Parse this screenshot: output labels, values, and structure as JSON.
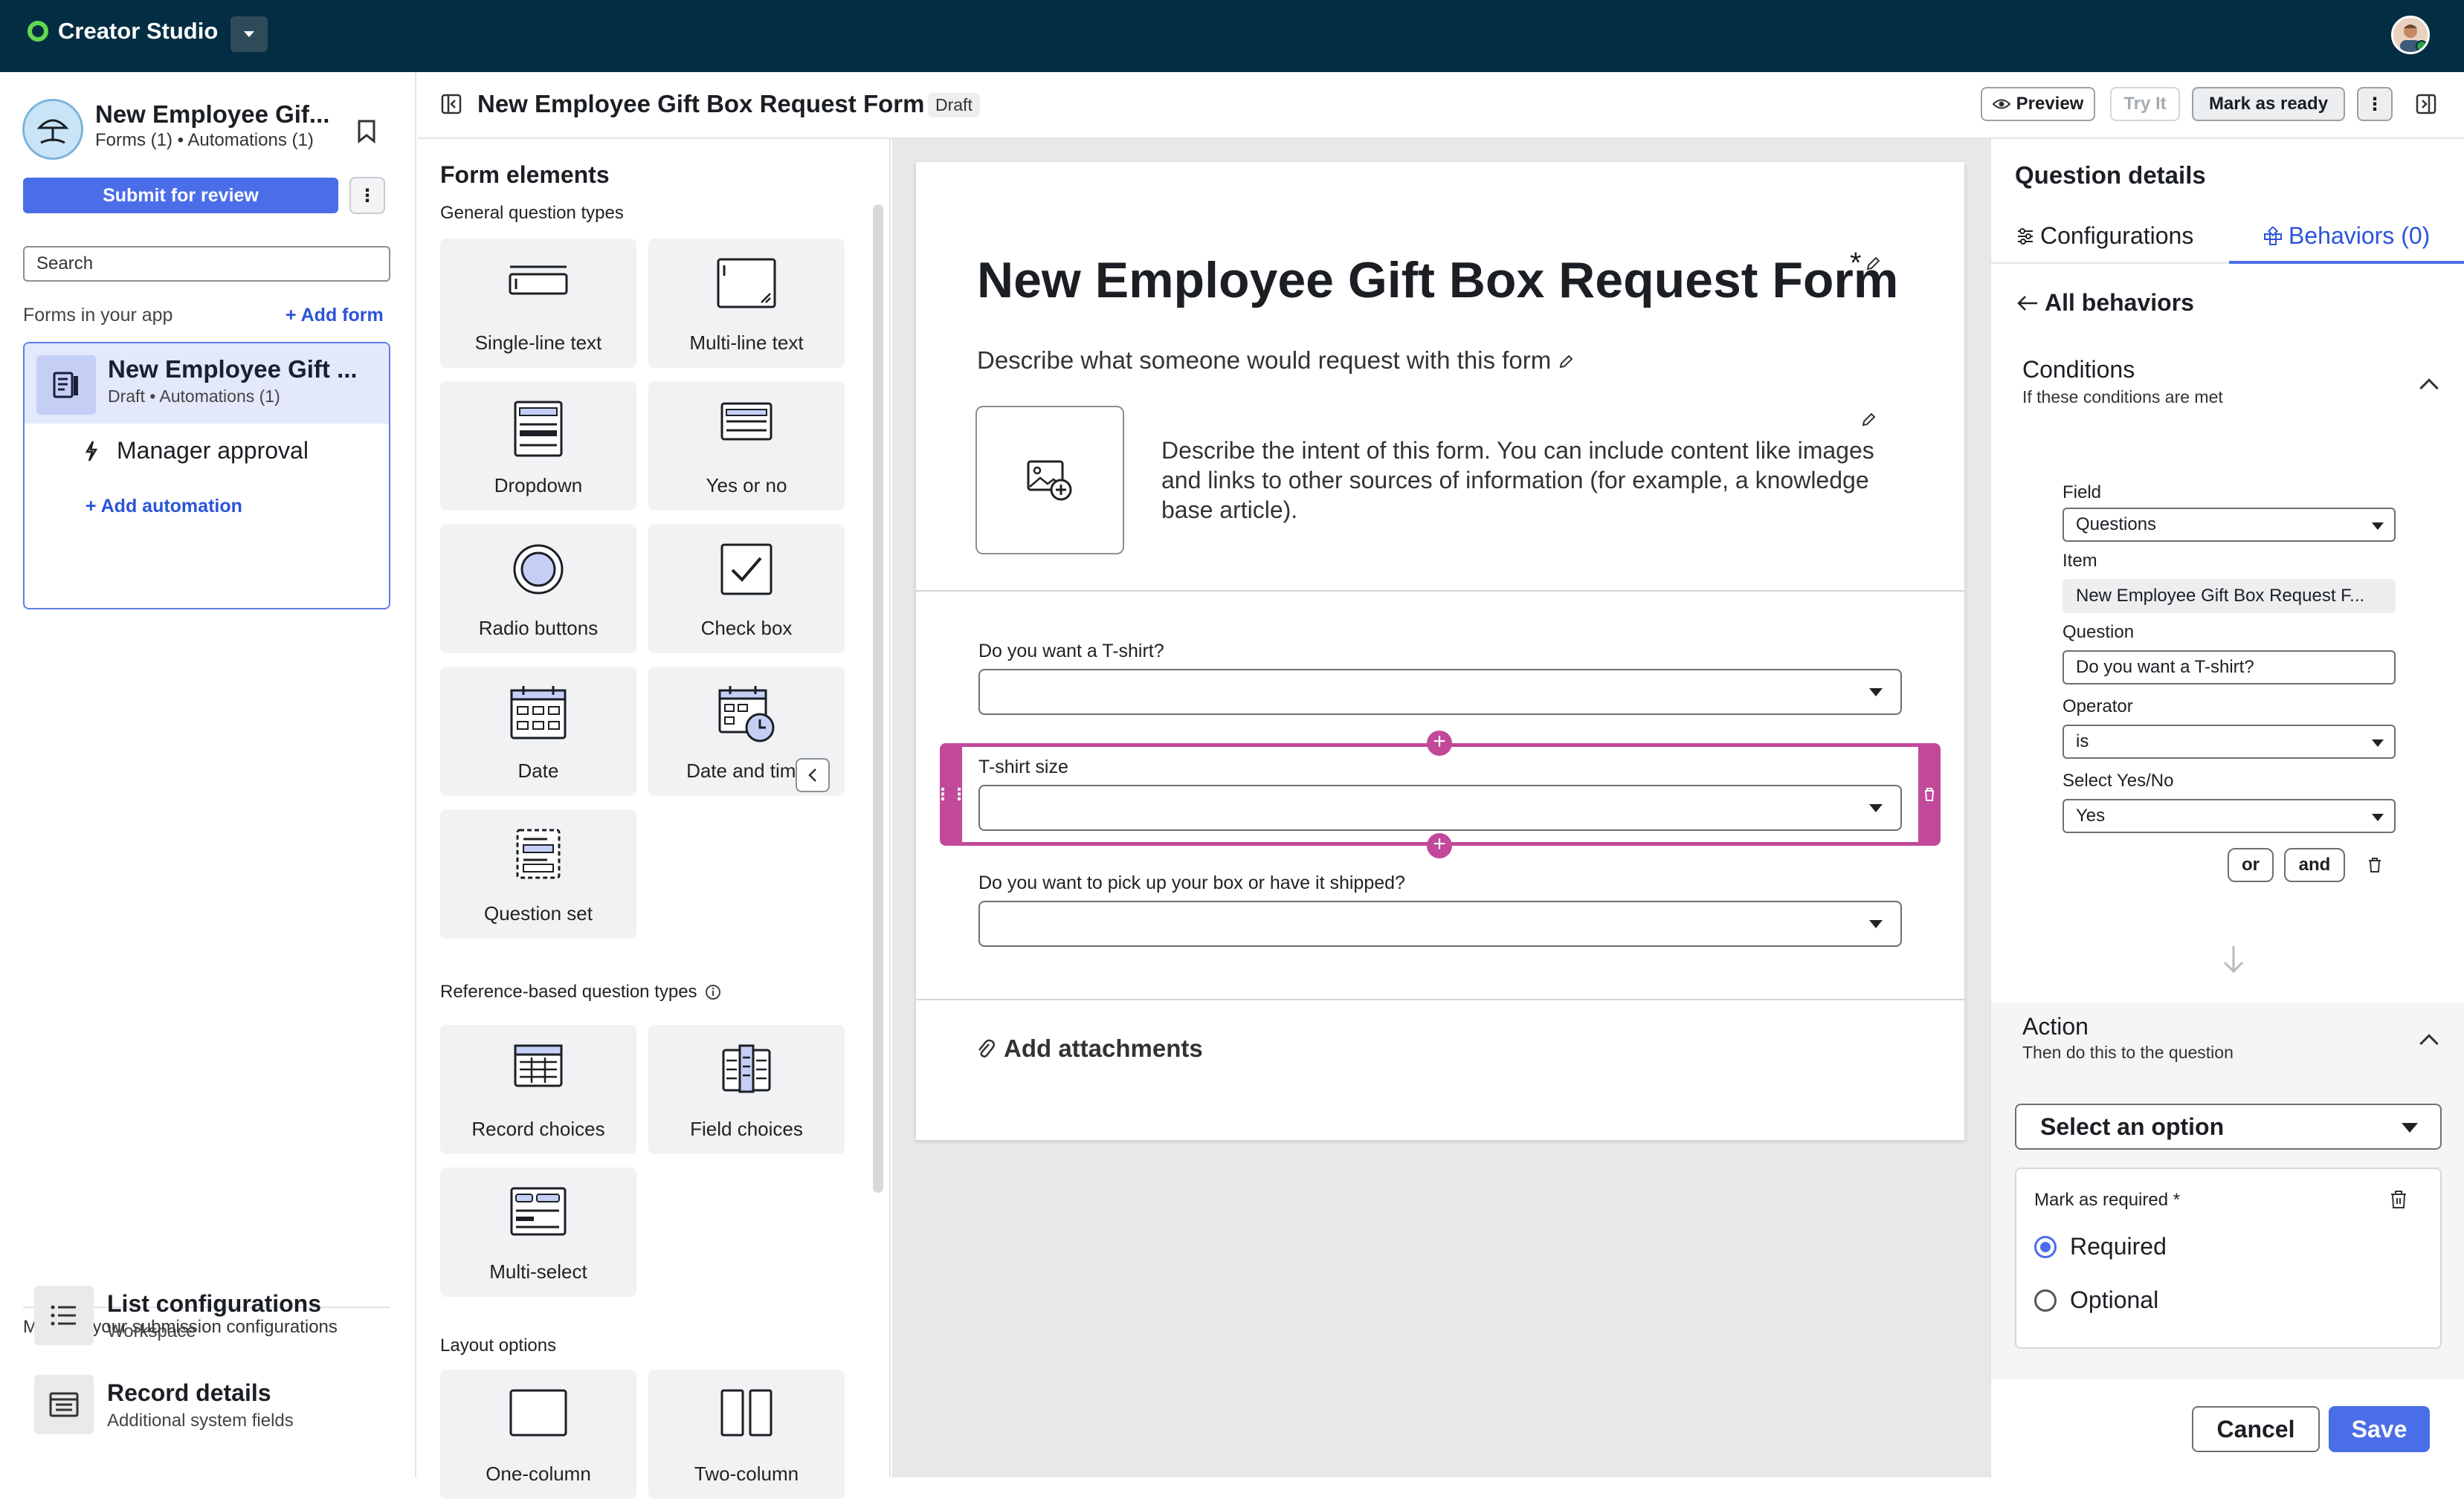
{
  "topbar": {
    "brand": "Creator Studio"
  },
  "sidebar": {
    "app_name": "New Employee Gif...",
    "app_sub": "Forms (1) • Automations (1)",
    "submit_label": "Submit for review",
    "search_placeholder": "Search",
    "forms_label": "Forms in your app",
    "add_form_label": "+ Add form",
    "form_card": {
      "title": "New Employee Gift ...",
      "sub": "Draft • Automations (1)",
      "automation": "Manager approval",
      "add_automation": "+ Add automation"
    },
    "manage_label": "Manage your submission configurations",
    "configs": [
      {
        "title": "List configurations",
        "sub": "Workspace",
        "icon": "list-icon"
      },
      {
        "title": "Record details",
        "sub": "Additional system fields",
        "icon": "record-icon"
      }
    ]
  },
  "header": {
    "title": "New Employee Gift Box Request Form",
    "status": "Draft",
    "preview_label": "Preview",
    "try_label": "Try It",
    "mark_ready_label": "Mark as ready"
  },
  "elements": {
    "heading": "Form elements",
    "general_label": "General question types",
    "general": [
      "Single-line text",
      "Multi-line text",
      "Dropdown",
      "Yes or no",
      "Radio buttons",
      "Check box",
      "Date",
      "Date and time",
      "Question set"
    ],
    "reference_label": "Reference-based question types",
    "reference": [
      "Record choices",
      "Field choices",
      "Multi-select"
    ],
    "layout_label": "Layout options",
    "layout": [
      "One-column",
      "Two-column"
    ]
  },
  "form": {
    "title": "New Employee Gift Box Request Form",
    "required_mark": "*",
    "description": "Describe what someone would request with this form",
    "intent": "Describe the intent of this form. You can include content like images and links to other sources of information (for example, a knowledge base article).",
    "questions": [
      {
        "label": "Do you want a T-shirt?"
      },
      {
        "label": "T-shirt size"
      },
      {
        "label": "Do you want to pick up your box or have it shipped?"
      }
    ],
    "attachments_label": "Add attachments"
  },
  "details": {
    "heading": "Question details",
    "tab_config": "Configurations",
    "tab_behaviors": "Behaviors (0)",
    "back_label": "All behaviors",
    "conditions_title": "Conditions",
    "conditions_sub": "If these conditions are met",
    "field_label": "Field",
    "field_value": "Questions",
    "item_label": "Item",
    "item_value": "New Employee Gift Box Request F...",
    "question_label": "Question",
    "question_value": "Do you want a T-shirt?",
    "operator_label": "Operator",
    "operator_value": "is",
    "yesno_label": "Select Yes/No",
    "yesno_value": "Yes",
    "or_label": "or",
    "and_label": "and",
    "action_title": "Action",
    "action_sub": "Then do this to the question",
    "select_option": "Select an option",
    "mark_required": "Mark as required",
    "required_mark": "*",
    "opt_required": "Required",
    "opt_optional": "Optional",
    "cancel_label": "Cancel",
    "save_label": "Save"
  }
}
